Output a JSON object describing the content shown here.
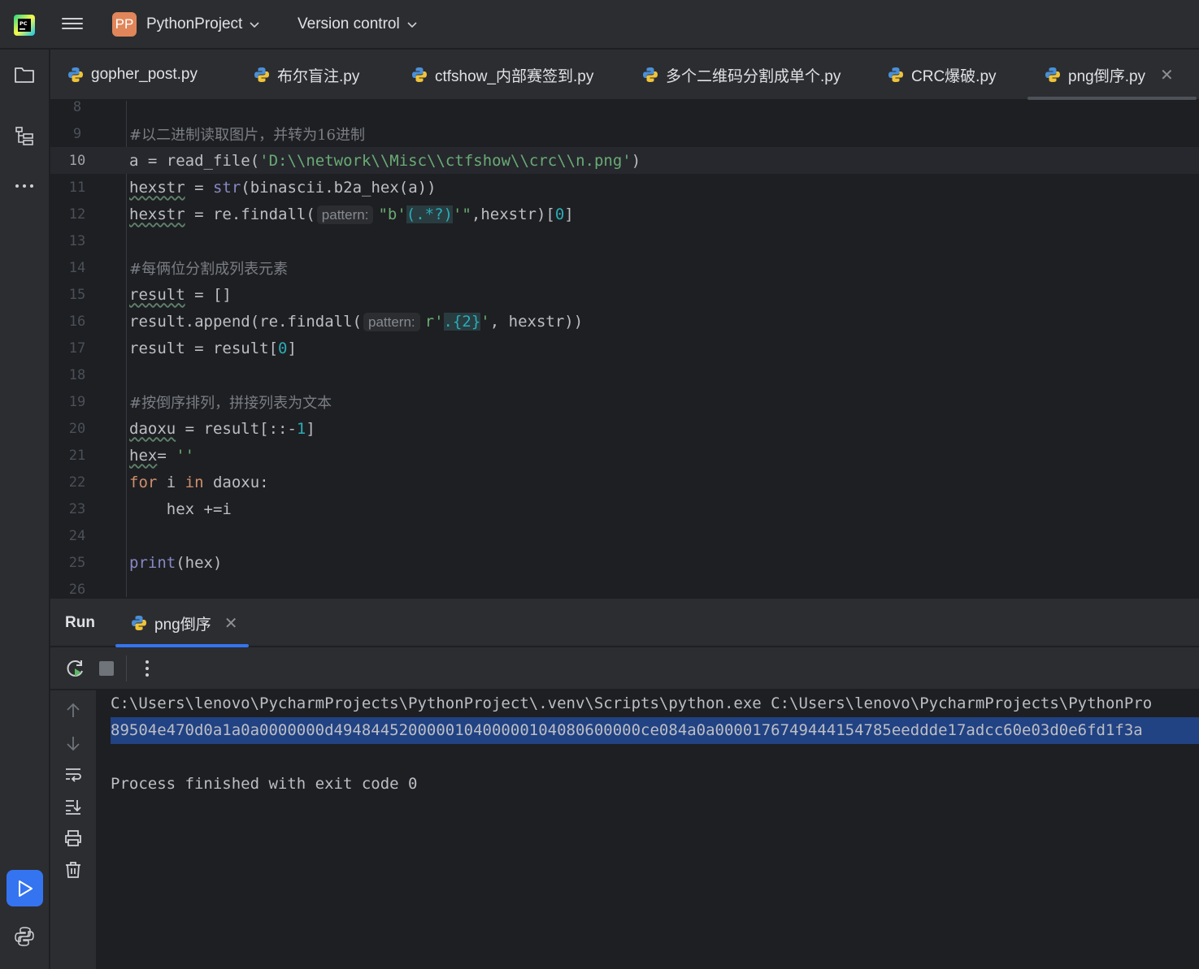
{
  "topbar": {
    "project_badge": "PP",
    "project_name": "PythonProject",
    "vcs_label": "Version control"
  },
  "tabs": [
    {
      "label": "gopher_post.py"
    },
    {
      "label": "布尔盲注.py"
    },
    {
      "label": "ctfshow_内部赛签到.py"
    },
    {
      "label": "多个二维码分割成单个.py"
    },
    {
      "label": "CRC爆破.py"
    },
    {
      "label": "png倒序.py",
      "active": true
    }
  ],
  "editor": {
    "line_numbers": [
      "8",
      "9",
      "10",
      "11",
      "12",
      "13",
      "14",
      "15",
      "16",
      "17",
      "18",
      "19",
      "20",
      "21",
      "22",
      "23",
      "24",
      "25",
      "26"
    ],
    "current_line": "10",
    "code": {
      "l9": "#以二进制读取图片，并转为16进制",
      "l10_a": "a = read_file(",
      "l10_s": "'D:\\\\network\\\\Misc\\\\ctfshow\\\\crc\\\\n.png'",
      "l10_b": ")",
      "l11_var": "hexstr",
      "l11_b": " = ",
      "l11_fn": "str",
      "l11_c": "(binascii.b2a_hex(a))",
      "l12_var": "hexstr",
      "l12_b": " = re.findall(",
      "l12_hint": "pattern:",
      "l12_s1": "\"b'",
      "l12_rx": "(.*?)",
      "l12_s2": "'\"",
      "l12_c": ",hexstr)[",
      "l12_n": "0",
      "l12_d": "]",
      "l14": "#每俩位分割成列表元素",
      "l15_var": "result",
      "l15_b": " = []",
      "l16_a": "result.append(re.findall(",
      "l16_hint": "pattern:",
      "l16_s1": "r'",
      "l16_rx": ".{2}",
      "l16_s2": "'",
      "l16_b": ", hexstr))",
      "l17_a": "result = result[",
      "l17_n": "0",
      "l17_b": "]",
      "l19": "#按倒序排列，拼接列表为文本",
      "l20_var": "daoxu",
      "l20_b": " = result[::-",
      "l20_n": "1",
      "l20_c": "]",
      "l21_var": "hex",
      "l21_b": "= ",
      "l21_s": "''",
      "l22_k1": "for",
      "l22_b": " i ",
      "l22_k2": "in",
      "l22_c": " daoxu:",
      "l23": "    hex +=i",
      "l25_fn": "print",
      "l25_b": "(hex)"
    }
  },
  "run_panel": {
    "title": "Run",
    "tab_label": "png倒序",
    "console": {
      "command": "C:\\Users\\lenovo\\PycharmProjects\\PythonProject\\.venv\\Scripts\\python.exe C:\\Users\\lenovo\\PycharmProjects\\PythonPro",
      "output": "89504e470d0a1a0a0000000d494844520000010400000104080600000ce084a0a00001767494441547​85eeddde17adcc60e03d0e6fd1f3a",
      "exit_message": "Process finished with exit code 0"
    }
  },
  "colors": {
    "accent": "#3574f0",
    "project_badge": "#e0865a",
    "selection": "#214283"
  },
  "icons": [
    "pycharm-logo-icon",
    "hamburger-menu-icon",
    "chevron-down-icon",
    "folder-icon",
    "structure-icon",
    "more-icon",
    "run-icon",
    "python-console-icon",
    "python-file-icon",
    "close-icon",
    "rerun-icon",
    "stop-icon",
    "kebab-icon",
    "arrow-up-icon",
    "arrow-down-icon",
    "soft-wrap-icon",
    "scroll-to-end-icon",
    "print-icon",
    "trash-icon"
  ]
}
